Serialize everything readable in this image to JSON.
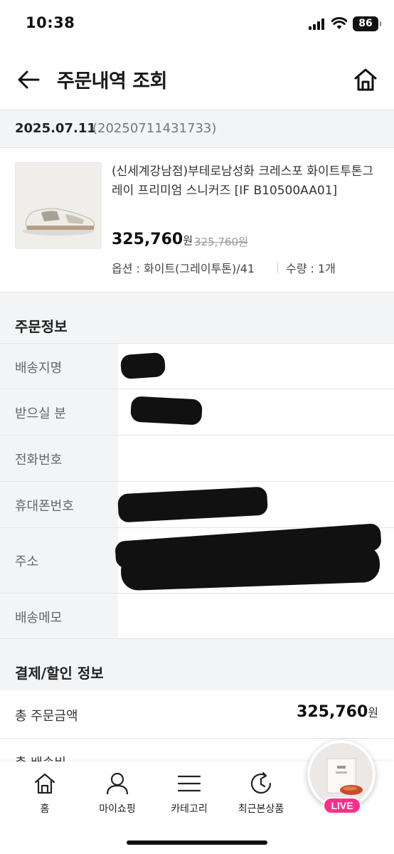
{
  "status": {
    "time": "10:38",
    "battery": "86"
  },
  "header": {
    "title": "주문내역 조회"
  },
  "order": {
    "date": "2025.07.11",
    "number": "(20250711431733)"
  },
  "product": {
    "name": "(신세계강남점)부테로남성화 크레스포 화이트투톤그레이 프리미엄 스니커즈 [IF B10500AA01]",
    "price": "325,760",
    "price_unit": "원",
    "original_price": "325,760원",
    "option": "옵션 : 화이트(그레이투톤)/41",
    "quantity": "수량 : 1개"
  },
  "order_info": {
    "title": "주문정보",
    "rows": [
      {
        "label": "배송지명"
      },
      {
        "label": "받으실 분"
      },
      {
        "label": "전화번호"
      },
      {
        "label": "휴대폰번호"
      },
      {
        "label": "주소"
      },
      {
        "label": "배송메모"
      }
    ]
  },
  "payment": {
    "title": "결제/할인 정보",
    "total_label": "총 주문금액",
    "total_value": "325,760",
    "total_unit": "원",
    "shipping_label": "총 배송비"
  },
  "nav": {
    "items": [
      {
        "label": "홈",
        "icon": "home-icon"
      },
      {
        "label": "마이쇼핑",
        "icon": "person-icon"
      },
      {
        "label": "카테고리",
        "icon": "menu-icon"
      },
      {
        "label": "최근본상품",
        "icon": "history-icon"
      }
    ],
    "live_label": "LIVE"
  }
}
